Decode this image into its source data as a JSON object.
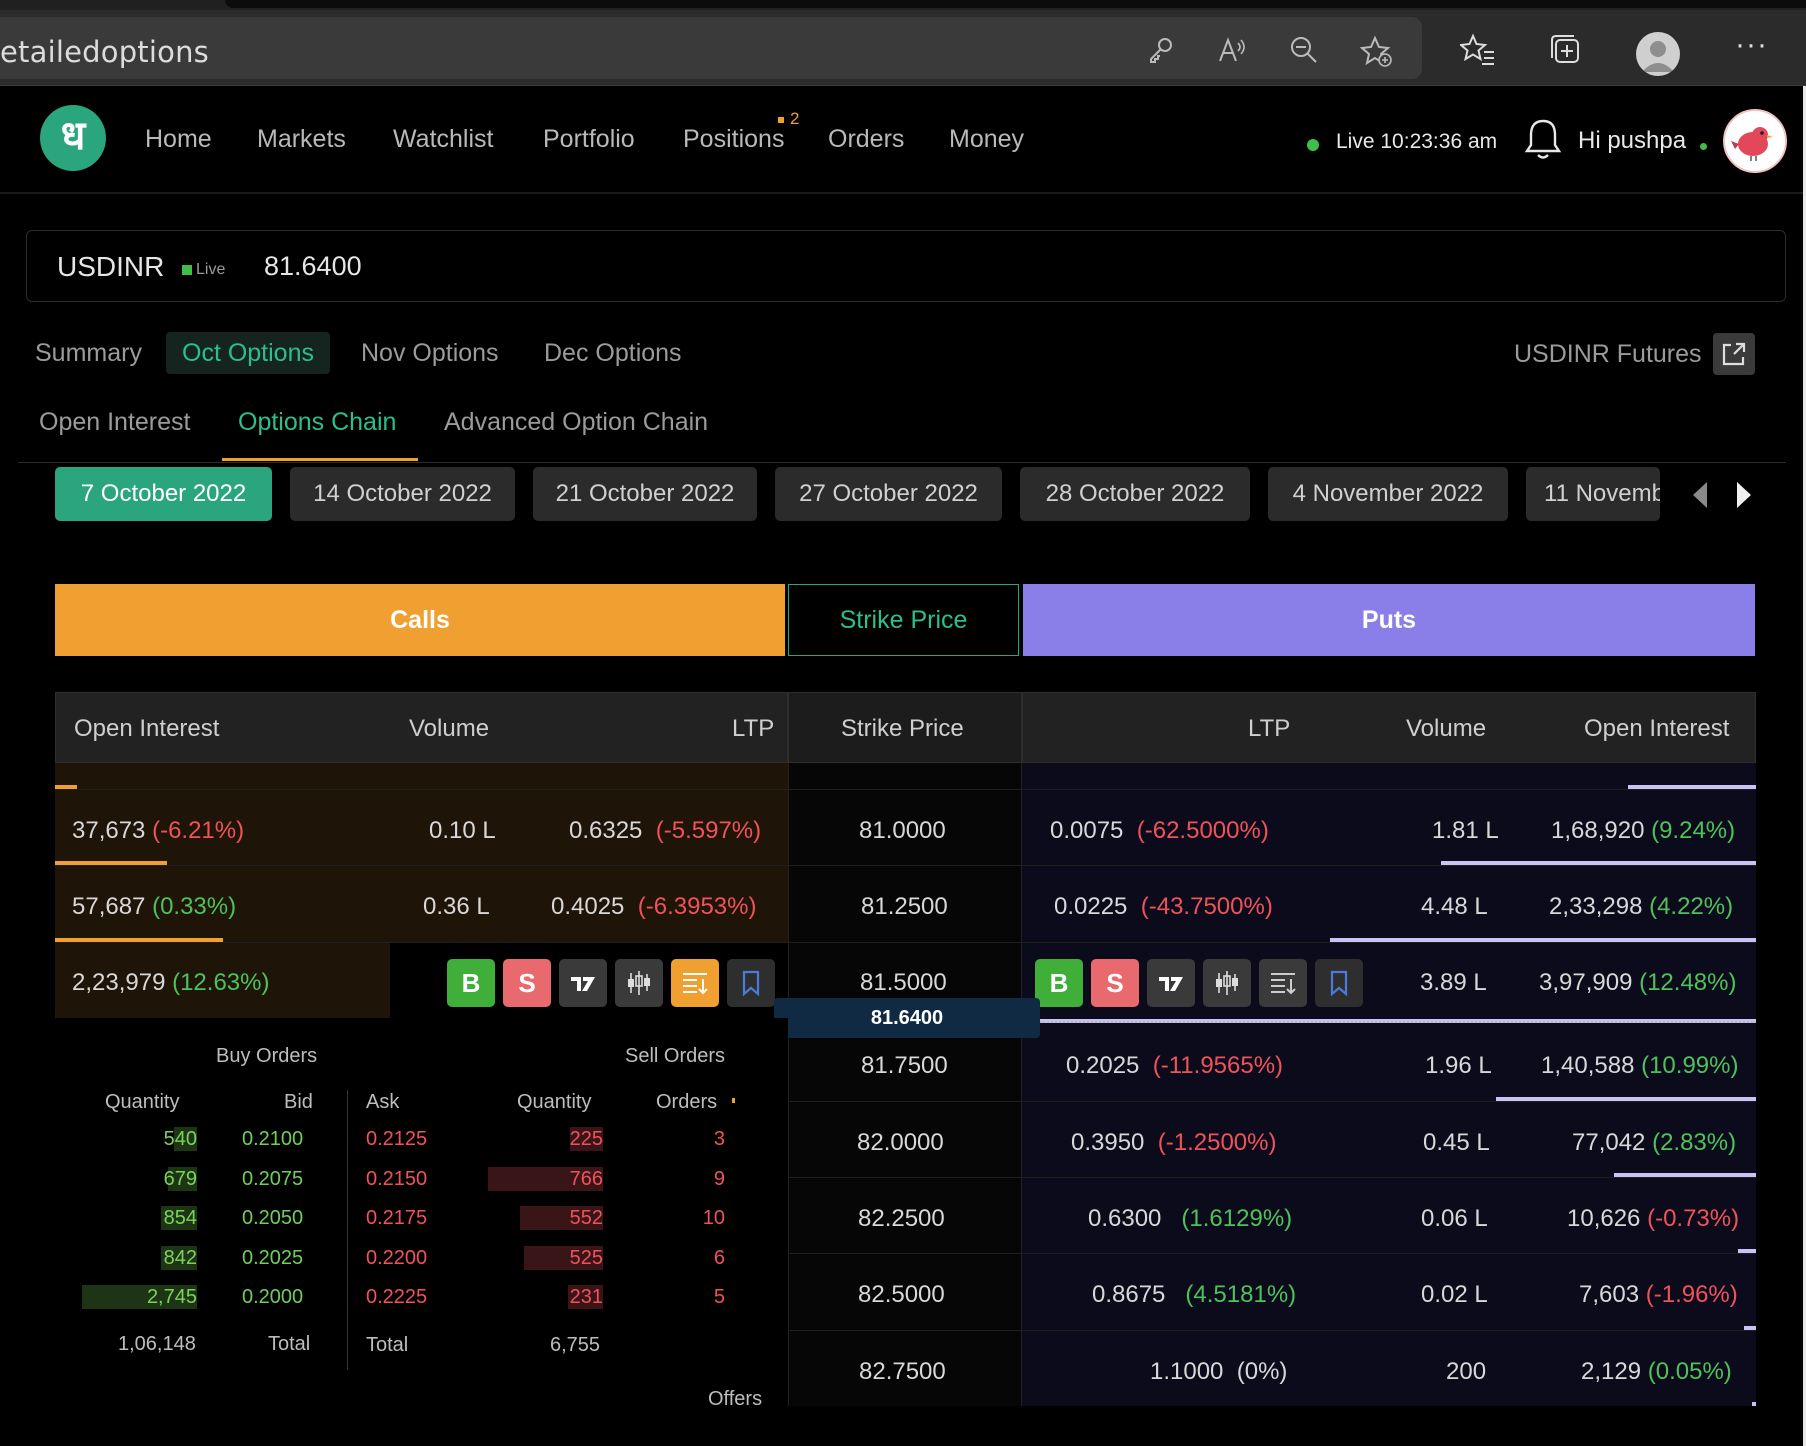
{
  "browser": {
    "url_fragment": "etailedoptions",
    "icons": [
      "key-icon",
      "read-aloud-icon",
      "zoom-out-icon",
      "add-favorite-icon",
      "favorites-icon",
      "collections-icon",
      "profile-icon",
      "more-icon"
    ]
  },
  "header": {
    "logo": "ध",
    "nav": [
      "Home",
      "Markets",
      "Watchlist",
      "Portfolio",
      "Positions",
      "Orders",
      "Money"
    ],
    "positions_badge": "2",
    "live_label": "Live",
    "time": "10:23:36 am",
    "greeting": "Hi pushpa"
  },
  "instrument": {
    "symbol": "USDINR",
    "live_badge": "Live",
    "ltp": "81.6400"
  },
  "tabs": {
    "primary": [
      "Summary",
      "Oct Options",
      "Nov Options",
      "Dec Options"
    ],
    "primary_active": "Oct Options",
    "futures_link": "USDINR Futures",
    "secondary": [
      "Open Interest",
      "Options Chain",
      "Advanced Option Chain"
    ],
    "secondary_active": "Options Chain"
  },
  "expiries": [
    "7 October 2022",
    "14 October 2022",
    "21 October 2022",
    "27 October 2022",
    "28 October 2022",
    "4 November 2022",
    "11 Novemb"
  ],
  "banner": {
    "calls": "Calls",
    "strike": "Strike Price",
    "puts": "Puts"
  },
  "columns": {
    "calls": [
      "Open Interest",
      "Volume",
      "LTP"
    ],
    "strike": "Strike Price",
    "puts": [
      "LTP",
      "Volume",
      "Open Interest"
    ]
  },
  "rows": [
    {
      "strike": "81.0000",
      "call_oi": "37,673",
      "call_oi_chg": "(-6.21%)",
      "call_vol": "0.10 L",
      "call_ltp": "0.6325",
      "call_ltp_chg": "(-5.597%)",
      "put_ltp": "0.0075",
      "put_ltp_chg": "(-62.5000%)",
      "put_vol": "1.81 L",
      "put_oi": "1,68,920",
      "put_oi_chg": "(9.24%)"
    },
    {
      "strike": "81.2500",
      "call_oi": "57,687",
      "call_oi_chg": "(0.33%)",
      "call_vol": "0.36 L",
      "call_ltp": "0.4025",
      "call_ltp_chg": "(-6.3953%)",
      "put_ltp": "0.0225",
      "put_ltp_chg": "(-43.7500%)",
      "put_vol": "4.48 L",
      "put_oi": "2,33,298",
      "put_oi_chg": "(4.22%)"
    },
    {
      "strike": "81.5000",
      "call_oi": "2,23,979",
      "call_oi_chg": "(12.63%)",
      "put_vol": "3.89 L",
      "put_oi": "3,97,909",
      "put_oi_chg": "(12.48%)",
      "actions": [
        "B",
        "S",
        "chart-icon",
        "option-chain-icon",
        "sort-icon",
        "bookmark-icon"
      ]
    },
    {
      "strike": "81.7500",
      "put_ltp": "0.2025",
      "put_ltp_chg": "(-11.9565%)",
      "put_vol": "1.96 L",
      "put_oi": "1,40,588",
      "put_oi_chg": "(10.99%)"
    },
    {
      "strike": "82.0000",
      "put_ltp": "0.3950",
      "put_ltp_chg": "(-1.2500%)",
      "put_vol": "0.45 L",
      "put_oi": "77,042",
      "put_oi_chg": "(2.83%)"
    },
    {
      "strike": "82.2500",
      "put_ltp": "0.6300",
      "put_ltp_chg": "(1.6129%)",
      "put_vol": "0.06 L",
      "put_oi": "10,626",
      "put_oi_chg": "(-0.73%)"
    },
    {
      "strike": "82.5000",
      "put_ltp": "0.8675",
      "put_ltp_chg": "(4.5181%)",
      "put_vol": "0.02 L",
      "put_oi": "7,603",
      "put_oi_chg": "(-1.96%)"
    },
    {
      "strike": "82.7500",
      "put_ltp": "1.1000",
      "put_ltp_chg": "(0%)",
      "put_vol": "200",
      "put_oi": "2,129",
      "put_oi_chg": "(0.05%)"
    }
  ],
  "spot_marker": "81.6400",
  "depth": {
    "buy_title": "Buy Orders",
    "sell_title": "Sell Orders",
    "headers": [
      "Quantity",
      "Bid",
      "Ask",
      "Quantity",
      "Orders"
    ],
    "levels": [
      {
        "bid_qty": "540",
        "bid": "0.2100",
        "ask": "0.2125",
        "ask_qty": "225",
        "orders": "3",
        "bid_share": 0.2,
        "ask_share": 0.29
      },
      {
        "bid_qty": "679",
        "bid": "0.2075",
        "ask": "0.2150",
        "ask_qty": "766",
        "orders": "9",
        "bid_share": 0.25,
        "ask_share": 1.0
      },
      {
        "bid_qty": "854",
        "bid": "0.2050",
        "ask": "0.2175",
        "ask_qty": "552",
        "orders": "10",
        "bid_share": 0.31,
        "ask_share": 0.72
      },
      {
        "bid_qty": "842",
        "bid": "0.2025",
        "ask": "0.2200",
        "ask_qty": "525",
        "orders": "6",
        "bid_share": 0.31,
        "ask_share": 0.69
      },
      {
        "bid_qty": "2,745",
        "bid": "0.2000",
        "ask": "0.2225",
        "ask_qty": "231",
        "orders": "5",
        "bid_share": 1.0,
        "ask_share": 0.3
      }
    ],
    "bid_total": "1,06,148",
    "total_label": "Total",
    "ask_total_label": "Total",
    "ask_total": "6,755",
    "offers_label": "Offers"
  }
}
